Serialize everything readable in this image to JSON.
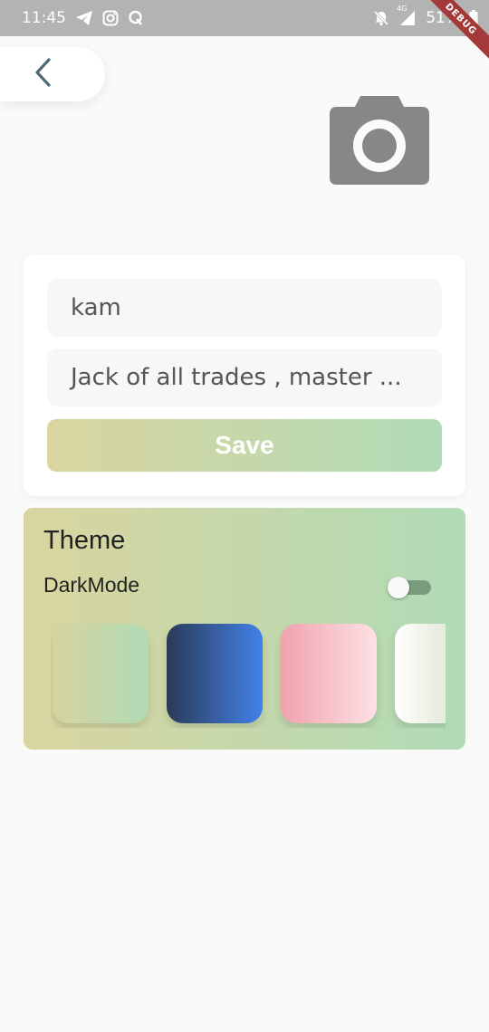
{
  "status_bar": {
    "time": "11:45",
    "network": "4G",
    "battery": "51%",
    "debug_banner": "DEBUG",
    "left_icons": [
      "telegram-icon",
      "instagram-icon",
      "quora-icon"
    ],
    "right_icons": [
      "notifications-off-icon",
      "signal-icon",
      "battery-icon"
    ]
  },
  "header": {
    "back_icon": "chevron-left-icon",
    "camera_icon": "camera-icon"
  },
  "profile": {
    "name_value": "kam",
    "bio_value": "Jack of all trades , master ...",
    "save_label": "Save"
  },
  "theme": {
    "title": "Theme",
    "dark_mode_label": "DarkMode",
    "dark_mode_on": false,
    "swatches": [
      {
        "name": "olive-mint",
        "from": "#d7d49e",
        "to": "#b1dab5"
      },
      {
        "name": "navy-blue",
        "from": "#2b3a58",
        "to": "#4182e8"
      },
      {
        "name": "pink-blush",
        "from": "#f0a2ad",
        "to": "#fde1e5"
      },
      {
        "name": "white-sage",
        "from": "#ffffff",
        "to": "#cfd9b8"
      }
    ]
  },
  "colors": {
    "accent_from": "#dad59f",
    "accent_to": "#b0dbb6",
    "status_bar": "#b3b3b3",
    "camera": "#878787",
    "back_chevron": "#4d6a7a"
  }
}
